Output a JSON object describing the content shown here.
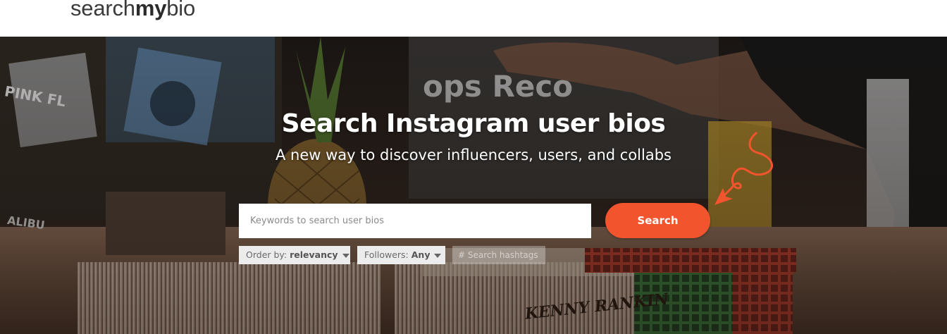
{
  "header": {
    "logo_part1": "search",
    "logo_part2": "my",
    "logo_part3": "bio"
  },
  "hero": {
    "title": "Search Instagram user bios",
    "subtitle": "A new way to discover influencers, users, and collabs"
  },
  "search": {
    "placeholder": "Keywords to search user bios",
    "value": "",
    "button_label": "Search"
  },
  "filters": {
    "order_label": "Order by:",
    "order_value": "relevancy",
    "followers_label": "Followers:",
    "followers_value": "Any",
    "hashtag_placeholder": "# Search hashtags"
  },
  "colors": {
    "accent": "#f2542d",
    "header_bg": "#ffffff",
    "logo_text": "#3a3a3a"
  },
  "icons": {
    "dropdown": "chevron-down-icon",
    "doodle": "squiggle-arrow-icon"
  }
}
